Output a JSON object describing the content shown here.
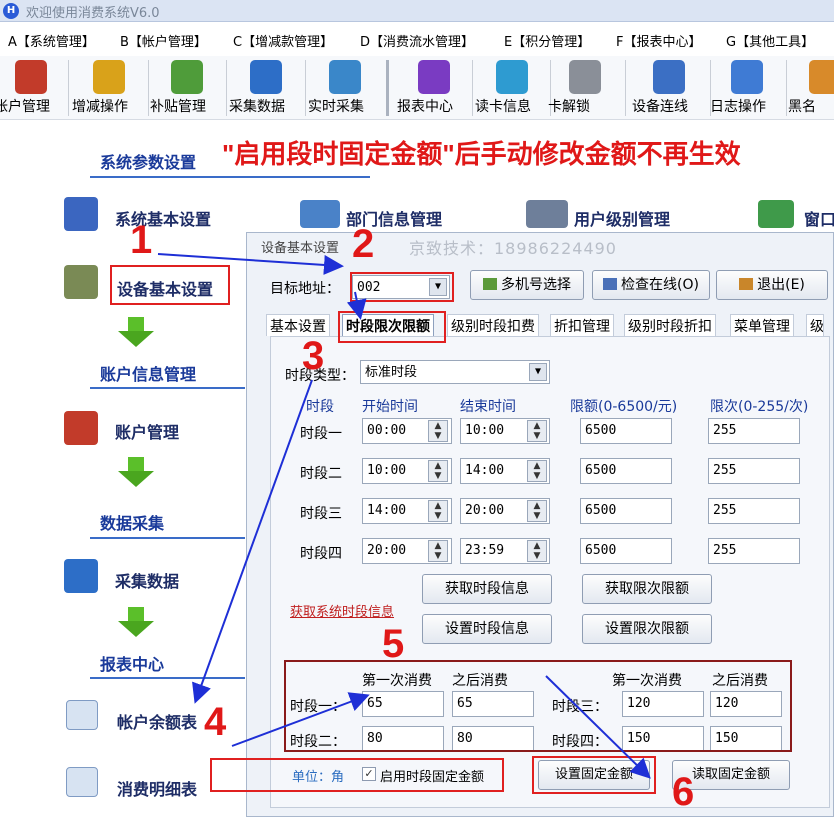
{
  "window": {
    "title": "欢迎使用消费系统V6.0"
  },
  "menu": [
    {
      "label": "A【系统管理】"
    },
    {
      "label": "B【帐户管理】"
    },
    {
      "label": "C【增减款管理】"
    },
    {
      "label": "D【消费流水管理】"
    },
    {
      "label": "E【积分管理】"
    },
    {
      "label": "F【报表中心】"
    },
    {
      "label": "G【其他工具】"
    }
  ],
  "toolbar": [
    {
      "label": "帐户管理",
      "icon": "users-icon",
      "color": "#c23b2a"
    },
    {
      "label": "增减操作",
      "icon": "money-user-icon",
      "color": "#d9a21a"
    },
    {
      "label": "补贴管理",
      "icon": "cash-icon",
      "color": "#4f9c3a"
    },
    {
      "label": "采集数据",
      "icon": "server-collect-icon",
      "color": "#2d6ec7"
    },
    {
      "label": "实时采集",
      "icon": "monitor-icon",
      "color": "#3a87c9"
    },
    {
      "label": "报表中心",
      "icon": "bar-chart-icon",
      "color": "#7a3bc2"
    },
    {
      "label": "读卡信息",
      "icon": "card-icon",
      "color": "#2e9bd1"
    },
    {
      "label": "卡解锁",
      "icon": "key-icon",
      "color": "#8a8f98"
    },
    {
      "label": "设备连线",
      "icon": "network-icon",
      "color": "#3b6fc4"
    },
    {
      "label": "日志操作",
      "icon": "log-icon",
      "color": "#3f7bd4"
    },
    {
      "label": "黑名",
      "icon": "blacklist-icon",
      "color": "#d88a2a"
    }
  ],
  "sidebar": {
    "sections": [
      {
        "title": "系统参数设置"
      },
      {
        "title": "账户信息管理"
      },
      {
        "title": "数据采集"
      },
      {
        "title": "报表中心"
      }
    ],
    "items": [
      {
        "label": "系统基本设置"
      },
      {
        "label": "设备基本设置"
      },
      {
        "label": "账户管理"
      },
      {
        "label": "采集数据"
      },
      {
        "label": "帐户余额表"
      },
      {
        "label": "消费明细表"
      }
    ]
  },
  "top_items": [
    {
      "label": "部门信息管理"
    },
    {
      "label": "用户级别管理"
    },
    {
      "label": "窗口"
    }
  ],
  "annotation": {
    "headline": "\"启用段时固定金额\"后手动修改金额不再生效",
    "steps": [
      "1",
      "2",
      "3",
      "4",
      "5",
      "6"
    ]
  },
  "dialog": {
    "title": "设备基本设置",
    "watermark": "京致技术：18986224490",
    "target_label": "目标地址：",
    "target_value": "002",
    "buttons": {
      "multi_select": "多机号选择",
      "check_online": "检查在线(O)",
      "exit": "退出(E)"
    },
    "tabs": [
      "基本设置",
      "时段限次限额",
      "级别时段扣费",
      "折扣管理",
      "级别时段折扣",
      "菜单管理",
      "级"
    ],
    "period_type_label": "时段类型：",
    "period_type_value": "标准时段",
    "headers": {
      "period": "时段",
      "start": "开始时间",
      "end": "结束时间",
      "limit_amount": "限额(0-6500/元)",
      "limit_count": "限次(0-255/次)"
    },
    "periods": [
      {
        "name": "时段一",
        "start": "00:00",
        "end": "10:00",
        "amount": "6500",
        "count": "255"
      },
      {
        "name": "时段二",
        "start": "10:00",
        "end": "14:00",
        "amount": "6500",
        "count": "255"
      },
      {
        "name": "时段三",
        "start": "14:00",
        "end": "20:00",
        "amount": "6500",
        "count": "255"
      },
      {
        "name": "时段四",
        "start": "20:00",
        "end": "23:59",
        "amount": "6500",
        "count": "255"
      }
    ],
    "actions": {
      "get_period": "获取时段信息",
      "set_period": "设置时段信息",
      "get_limit": "获取限次限额",
      "set_limit": "设置限次限额",
      "get_system_period": "获取系统时段信息"
    },
    "fixed": {
      "first_label": "第一次消费",
      "after_label": "之后消费",
      "rows": [
        {
          "name": "时段一：",
          "first": "65",
          "after": "65"
        },
        {
          "name": "时段二：",
          "first": "80",
          "after": "80"
        },
        {
          "name": "时段三：",
          "first": "120",
          "after": "120"
        },
        {
          "name": "时段四：",
          "first": "150",
          "after": "150"
        }
      ],
      "unit": "单位：角",
      "enable_label": "启用时段固定金额",
      "enable_checked": true,
      "set_button": "设置固定金额",
      "get_button": "读取固定金额"
    }
  }
}
